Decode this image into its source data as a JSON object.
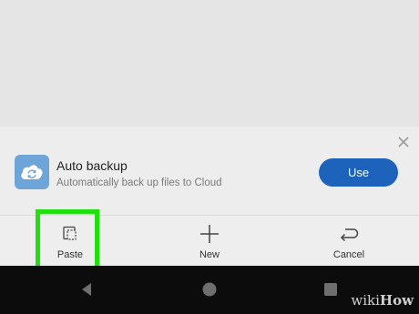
{
  "banner": {
    "title": "Auto backup",
    "subtitle": "Automatically back up files to Cloud",
    "use_label": "Use",
    "icon": "cloud-sync-icon",
    "close_icon": "close-icon"
  },
  "action_bar": {
    "items": [
      {
        "label": "Paste",
        "icon": "paste-icon",
        "highlighted": true
      },
      {
        "label": "New",
        "icon": "plus-icon"
      },
      {
        "label": "Cancel",
        "icon": "return-arrow-icon"
      }
    ]
  },
  "nav_bar": {
    "buttons": [
      "back-icon",
      "home-icon",
      "recents-icon"
    ]
  },
  "watermark": {
    "prefix": "wiki",
    "suffix": "How"
  },
  "colors": {
    "accent": "#1d63bc",
    "highlight": "#22e010",
    "cloud_tile": "#6ea5d9"
  }
}
